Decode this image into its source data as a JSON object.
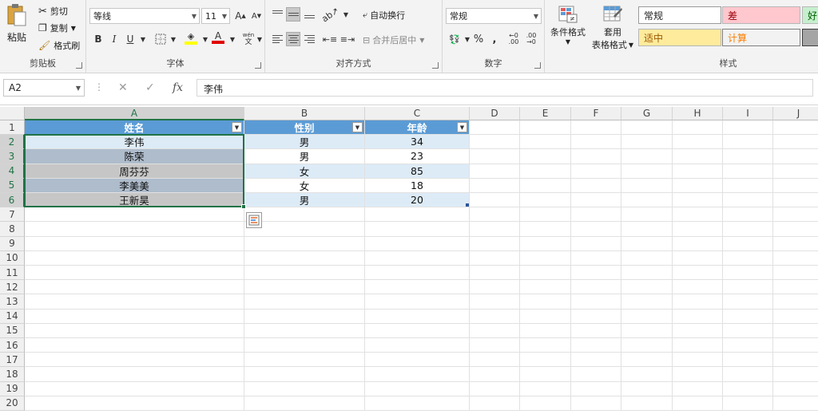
{
  "ribbon": {
    "clipboard": {
      "paste": "粘贴",
      "cut": "剪切",
      "copy": "复制",
      "format_painter": "格式刷",
      "label": "剪贴板"
    },
    "font": {
      "name": "等线",
      "size": "11",
      "label": "字体"
    },
    "alignment": {
      "wrap": "自动换行",
      "merge": "合并后居中",
      "label": "对齐方式"
    },
    "number": {
      "format": "常规",
      "label": "数字"
    },
    "styles": {
      "cond_format": "条件格式",
      "table_format_1": "套用",
      "table_format_2": "表格格式",
      "normal": "常规",
      "bad": "差",
      "good": "好",
      "neutral": "适中",
      "calc": "计算",
      "label": "样式"
    }
  },
  "formula_bar": {
    "name_box": "A2",
    "value": "李伟"
  },
  "sheet": {
    "columns": [
      "A",
      "B",
      "C",
      "D",
      "E",
      "F",
      "G",
      "H",
      "I",
      "J"
    ],
    "rows": [
      "1",
      "2",
      "3",
      "4",
      "5",
      "6",
      "7",
      "8",
      "9",
      "10",
      "11",
      "12",
      "13",
      "14",
      "15",
      "16",
      "17",
      "18",
      "19",
      "20"
    ],
    "table": {
      "headers": [
        "姓名",
        "性别",
        "年龄"
      ],
      "rows": [
        [
          "李伟",
          "男",
          "34"
        ],
        [
          "陈荣",
          "男",
          "23"
        ],
        [
          "周芬芬",
          "女",
          "85"
        ],
        [
          "李美美",
          "女",
          "18"
        ],
        [
          "王新昊",
          "男",
          "20"
        ]
      ]
    }
  },
  "colors": {
    "header_fill": "#5b9bd5",
    "band_light": "#ddebf7",
    "selection_fill": "#c6c6c6",
    "selection_dark": "#aebccc",
    "selection_border": "#217346"
  }
}
